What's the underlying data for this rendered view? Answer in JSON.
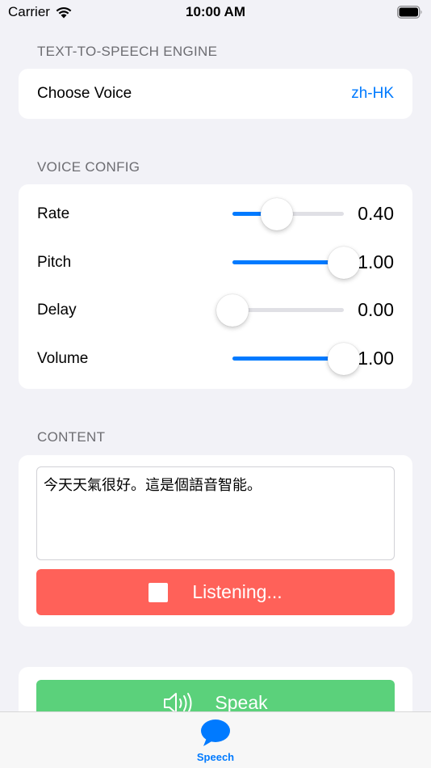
{
  "status_bar": {
    "carrier": "Carrier",
    "time": "10:00 AM"
  },
  "engine_section": {
    "title": "TEXT-TO-SPEECH ENGINE",
    "choose_voice_label": "Choose Voice",
    "voice_value": "zh-HK"
  },
  "voice_config": {
    "title": "VOICE CONFIG",
    "sliders": [
      {
        "label": "Rate",
        "value": 0.4,
        "value_text": "0.40"
      },
      {
        "label": "Pitch",
        "value": 1.0,
        "value_text": "1.00"
      },
      {
        "label": "Delay",
        "value": 0.0,
        "value_text": "0.00"
      },
      {
        "label": "Volume",
        "value": 1.0,
        "value_text": "1.00"
      }
    ]
  },
  "content_section": {
    "title": "CONTENT",
    "text": "今天天氣很好。這是個語音智能。",
    "listening_label": "Listening..."
  },
  "speak": {
    "label": "Speak"
  },
  "tab_bar": {
    "items": [
      {
        "label": "Speech",
        "icon": "speech-bubble-icon"
      }
    ]
  },
  "colors": {
    "accent": "#007aff",
    "listening": "#ff6159",
    "speak": "#5bd17b"
  }
}
